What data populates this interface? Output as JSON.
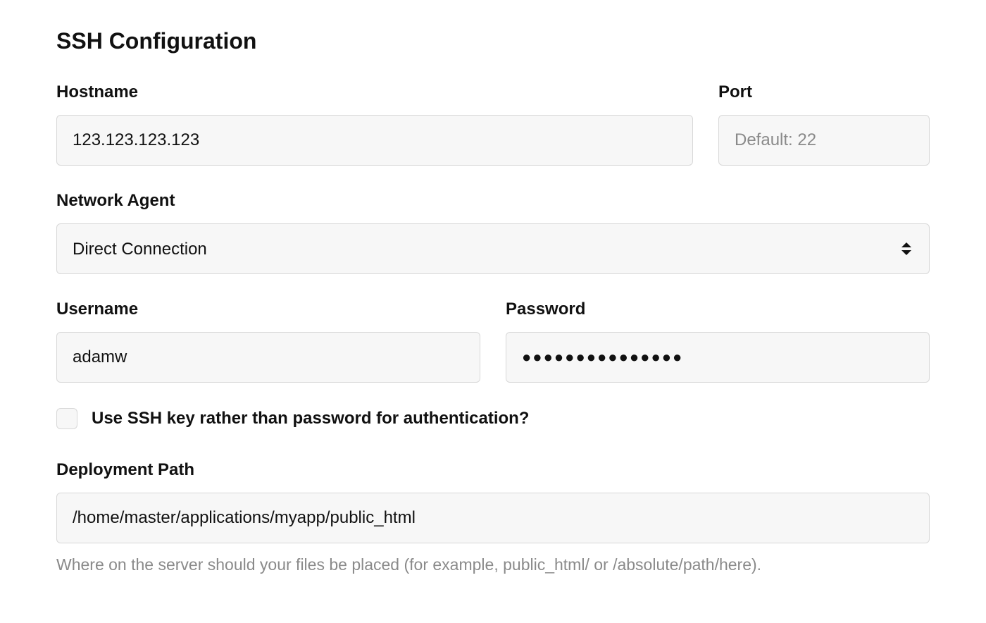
{
  "section": {
    "title": "SSH Configuration"
  },
  "hostname": {
    "label": "Hostname",
    "value": "123.123.123.123"
  },
  "port": {
    "label": "Port",
    "placeholder": "Default: 22",
    "value": ""
  },
  "network_agent": {
    "label": "Network Agent",
    "selected": "Direct Connection"
  },
  "username": {
    "label": "Username",
    "value": "adamw"
  },
  "password": {
    "label": "Password",
    "masked": "●●●●●●●●●●●●●●●"
  },
  "ssh_key_checkbox": {
    "label": "Use SSH key rather than password for authentication?",
    "checked": false
  },
  "deployment_path": {
    "label": "Deployment Path",
    "value": "/home/master/applications/myapp/public_html",
    "help_prefix": "Where on the server should your files be placed (for example, ",
    "help_sample1": "public_html/",
    "help_mid": " or ",
    "help_sample2": "/absolute/path/here",
    "help_suffix": ")."
  }
}
